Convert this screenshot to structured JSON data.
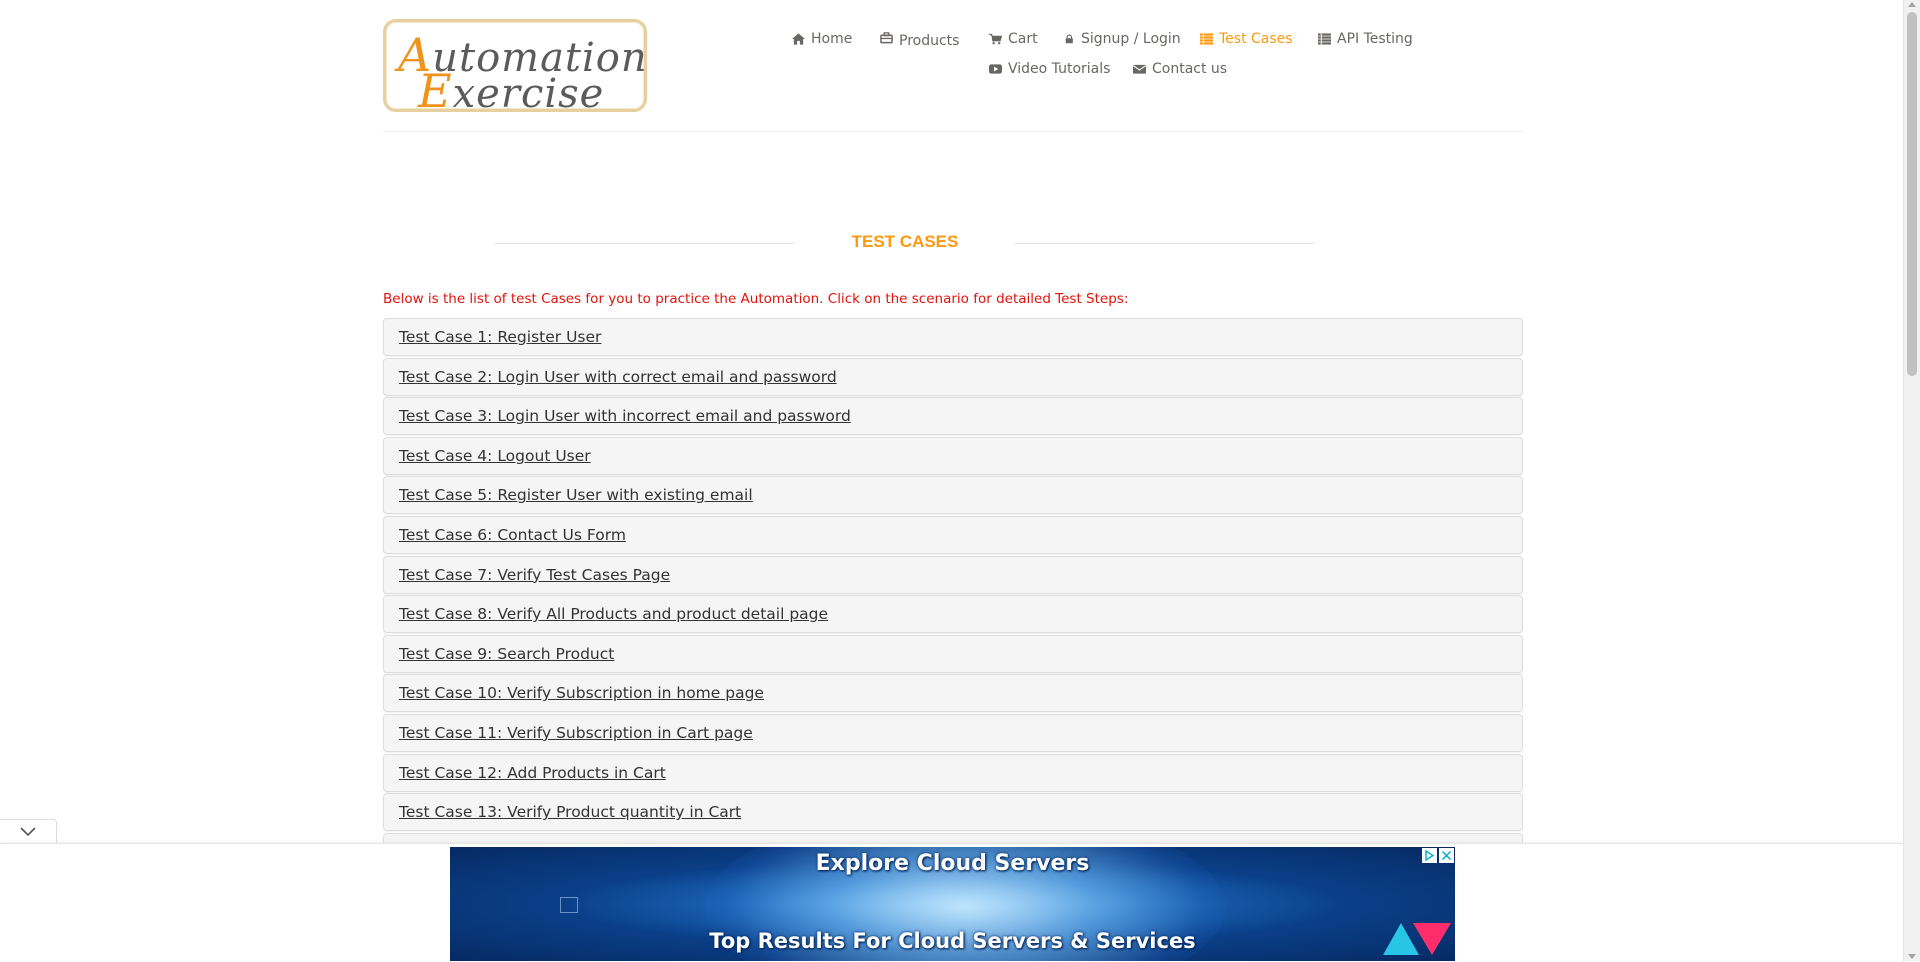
{
  "logo": {
    "line1_cap": "A",
    "line1_rest": "utomation",
    "line2_cap": "E",
    "line2_rest": "xercise"
  },
  "nav": {
    "home": "Home",
    "products": "Products",
    "cart": "Cart",
    "signup": "Signup / Login",
    "test_cases": "Test Cases",
    "api_testing": "API Testing",
    "video_tutorials": "Video Tutorials",
    "contact": "Contact us",
    "active_color": "#fe980f"
  },
  "page": {
    "title": "TEST CASES",
    "description": "Below is the list of test Cases for you to practice the Automation. Click on the scenario for detailed Test Steps:"
  },
  "test_cases": [
    "Test Case 1: Register User",
    "Test Case 2: Login User with correct email and password",
    "Test Case 3: Login User with incorrect email and password",
    "Test Case 4: Logout User",
    "Test Case 5: Register User with existing email",
    "Test Case 6: Contact Us Form",
    "Test Case 7: Verify Test Cases Page",
    "Test Case 8: Verify All Products and product detail page",
    "Test Case 9: Search Product",
    "Test Case 10: Verify Subscription in home page",
    "Test Case 11: Verify Subscription in Cart page",
    "Test Case 12: Add Products in Cart",
    "Test Case 13: Verify Product quantity in Cart"
  ],
  "ad": {
    "headline": "Explore Cloud Servers",
    "subline": "Top Results For Cloud Servers & Services"
  },
  "icons": {
    "home": "home-icon",
    "products": "products-icon",
    "cart": "cart-icon",
    "signup": "lock-icon",
    "test_cases": "list-icon",
    "api_testing": "list-icon",
    "video": "youtube-icon",
    "contact": "envelope-icon",
    "collapse": "chevron-down-icon"
  }
}
